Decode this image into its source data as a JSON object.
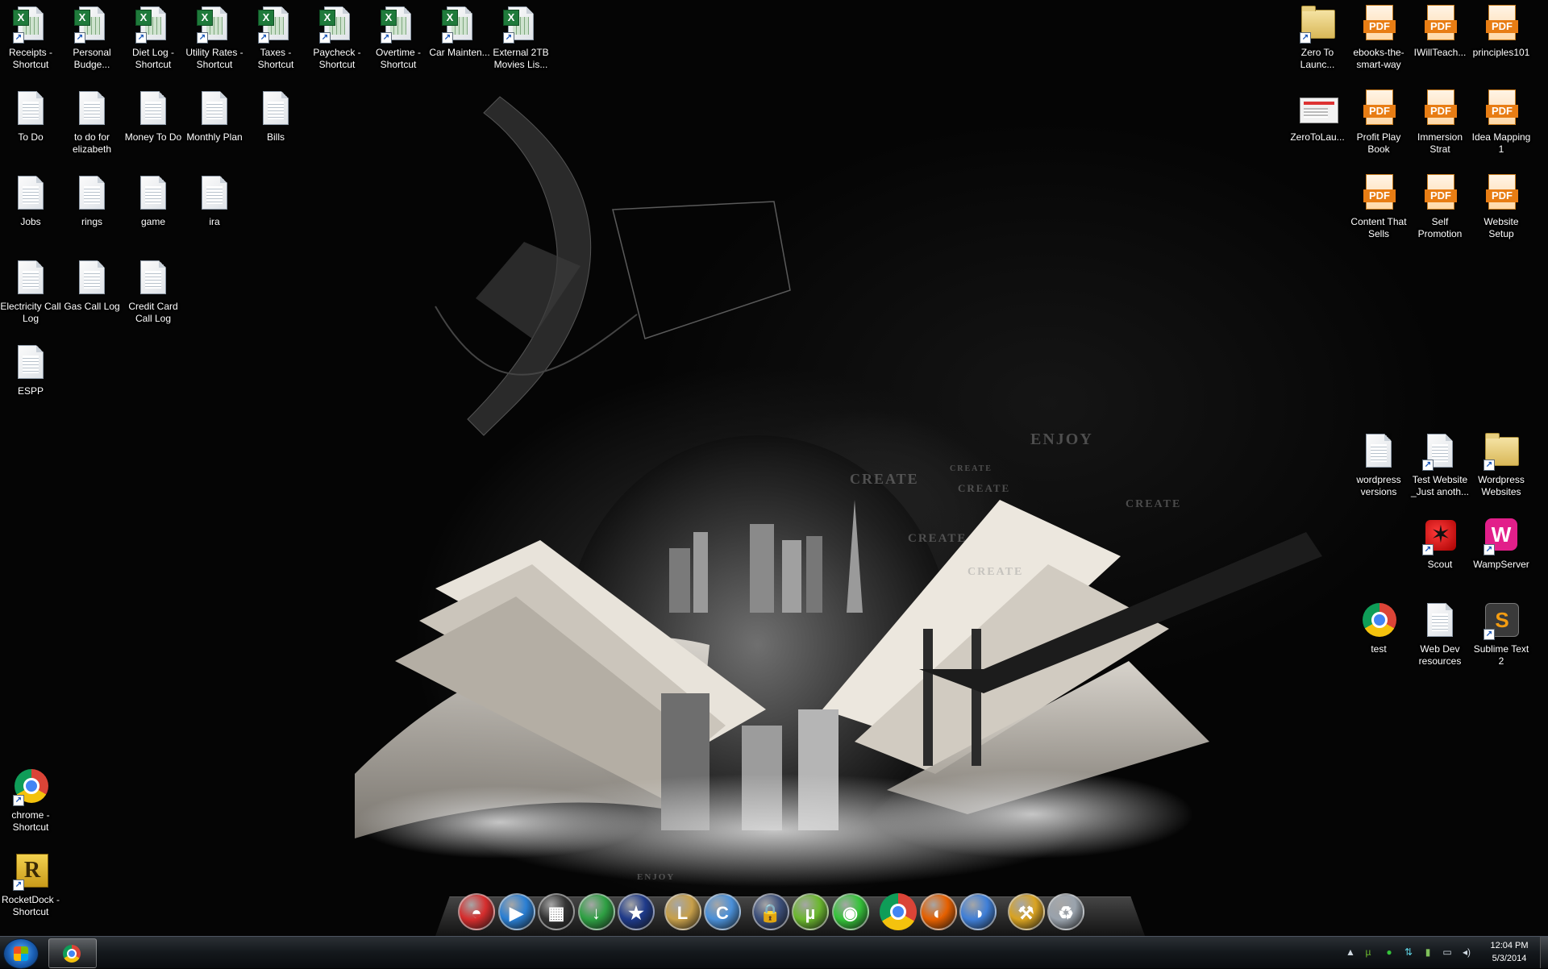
{
  "desktop": {
    "wallpaper_words": [
      "ENJOY",
      "CREATE",
      "CREATE",
      "CREATE",
      "CREATE",
      "CREATE",
      "CREATE",
      "ENJOY"
    ],
    "left_icons": [
      {
        "label": "Receipts - Shortcut",
        "icon": "excel-shortcut-icon"
      },
      {
        "label": "Personal Budge...",
        "icon": "excel-shortcut-icon"
      },
      {
        "label": "Diet Log - Shortcut",
        "icon": "excel-shortcut-icon"
      },
      {
        "label": "Utility Rates - Shortcut",
        "icon": "excel-shortcut-icon"
      },
      {
        "label": "Taxes - Shortcut",
        "icon": "excel-shortcut-icon"
      },
      {
        "label": "Paycheck - Shortcut",
        "icon": "excel-shortcut-icon"
      },
      {
        "label": "Overtime - Shortcut",
        "icon": "excel-shortcut-icon"
      },
      {
        "label": "Car Mainten...",
        "icon": "excel-shortcut-icon"
      },
      {
        "label": "External 2TB Movies Lis...",
        "icon": "excel-shortcut-icon"
      },
      {
        "label": "To Do",
        "icon": "text-file-icon"
      },
      {
        "label": "to do for elizabeth",
        "icon": "text-file-icon"
      },
      {
        "label": "Money To Do",
        "icon": "text-file-icon"
      },
      {
        "label": "Monthly Plan",
        "icon": "text-file-icon"
      },
      {
        "label": "Bills",
        "icon": "text-file-icon"
      },
      {
        "label": "Jobs",
        "icon": "text-file-icon"
      },
      {
        "label": "rings",
        "icon": "text-file-icon"
      },
      {
        "label": "game",
        "icon": "text-file-icon"
      },
      {
        "label": "ira",
        "icon": "text-file-icon"
      },
      {
        "label": "Electricity Call Log",
        "icon": "text-file-icon"
      },
      {
        "label": "Gas Call Log",
        "icon": "text-file-icon"
      },
      {
        "label": "Credit Card Call Log",
        "icon": "text-file-icon"
      },
      {
        "label": "ESPP",
        "icon": "text-file-icon"
      },
      {
        "label": "chrome - Shortcut",
        "icon": "chrome-icon"
      },
      {
        "label": "RocketDock - Shortcut",
        "icon": "rocketdock-icon"
      }
    ],
    "right_icons": [
      {
        "label": "Zero To Launc...",
        "icon": "folder-shortcut-icon"
      },
      {
        "label": "ebooks-the-smart-way",
        "icon": "pdf-icon"
      },
      {
        "label": "IWillTeach...",
        "icon": "pdf-icon"
      },
      {
        "label": "principles101",
        "icon": "pdf-icon"
      },
      {
        "label": "ZeroToLau...",
        "icon": "webpage-thumbnail-icon"
      },
      {
        "label": "Profit Play Book",
        "icon": "pdf-icon"
      },
      {
        "label": "Immersion Strat",
        "icon": "pdf-icon"
      },
      {
        "label": "Idea Mapping 1",
        "icon": "pdf-icon"
      },
      {
        "label": "Content That Sells",
        "icon": "pdf-icon"
      },
      {
        "label": "Self Promotion",
        "icon": "pdf-icon"
      },
      {
        "label": "Website Setup",
        "icon": "pdf-icon"
      },
      {
        "label": "wordpress versions",
        "icon": "text-file-icon"
      },
      {
        "label": "Test Website _Just anoth...",
        "icon": "text-file-shortcut-icon"
      },
      {
        "label": "Wordpress Websites",
        "icon": "folder-shortcut-icon"
      },
      {
        "label": "Scout",
        "icon": "scout-icon"
      },
      {
        "label": "WampServer",
        "icon": "wampserver-icon"
      },
      {
        "label": "test",
        "icon": "chrome-icon"
      },
      {
        "label": "Web Dev resources",
        "icon": "text-file-icon"
      },
      {
        "label": "Sublime Text 2",
        "icon": "sublime-text-icon"
      }
    ]
  },
  "dock": {
    "items": [
      {
        "icon": "pokeball-icon",
        "color": "#d62d2d"
      },
      {
        "icon": "media-player-icon",
        "color": "#2a7fd4"
      },
      {
        "icon": "video-editor-icon",
        "color": "#333333"
      },
      {
        "icon": "download-arrow-icon",
        "color": "#2ea043"
      },
      {
        "icon": "star-launcher-icon",
        "color": "#1e3a8a"
      },
      {
        "icon": "league-of-legends-icon",
        "color": "#c8a04a"
      },
      {
        "icon": "curse-client-icon",
        "color": "#4a90d9"
      },
      {
        "icon": "lock-security-icon",
        "color": "#3c4f7a"
      },
      {
        "icon": "utorrent-icon",
        "color": "#6bb82e"
      },
      {
        "icon": "vpn-icon",
        "color": "#35c43a"
      },
      {
        "icon": "chrome-icon",
        "color": "#db4437"
      },
      {
        "icon": "firefox-icon",
        "color": "#e66000"
      },
      {
        "icon": "eclipse-icon",
        "color": "#3f7fd8"
      },
      {
        "icon": "tools-icon",
        "color": "#d9a321"
      },
      {
        "icon": "recycle-bin-icon",
        "color": "#9aa3ad"
      }
    ]
  },
  "taskbar": {
    "clock_time": "12:04 PM",
    "clock_date": "5/3/2014",
    "tray_icons": [
      "show-hidden-icons-chevron-icon",
      "utorrent-tray-icon",
      "vpn-tray-icon",
      "network-activity-icon",
      "power-icon",
      "display-icon",
      "volume-icon"
    ]
  }
}
